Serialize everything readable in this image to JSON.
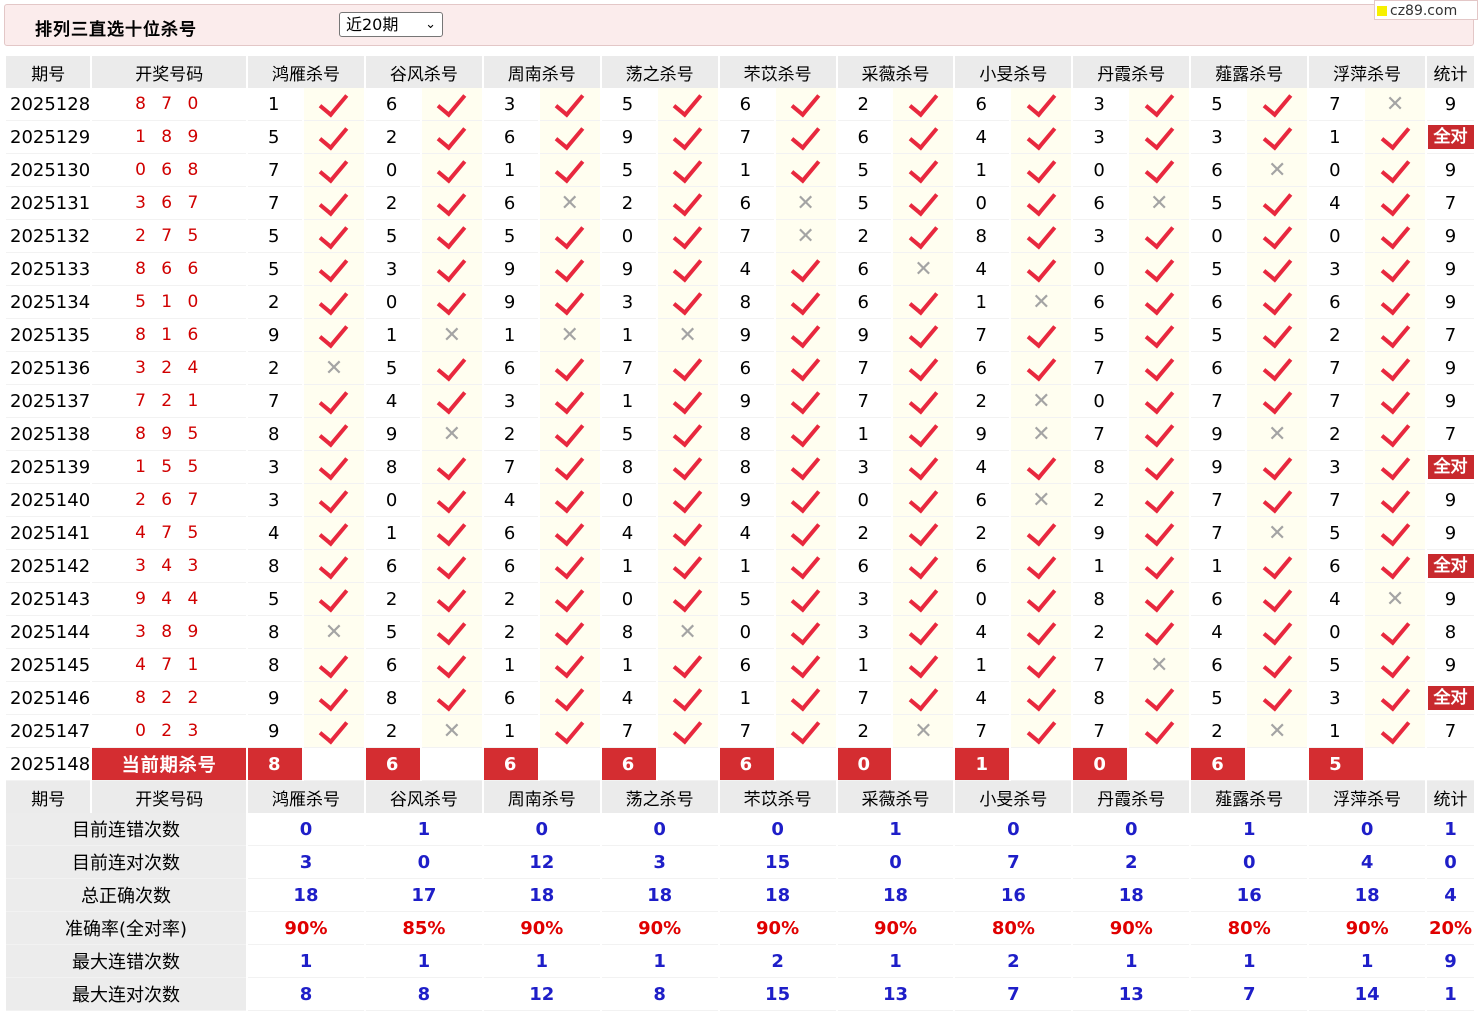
{
  "title": "排列三直选十位杀号",
  "period_select": {
    "value": "近20期",
    "options": [
      "近20期"
    ]
  },
  "watermark": "cz89.com",
  "headers": {
    "period": "期号",
    "draw": "开奖号码",
    "stat": "统计"
  },
  "experts": [
    "鸿雁杀号",
    "谷风杀号",
    "周南杀号",
    "荡之杀号",
    "芣苡杀号",
    "采薇杀号",
    "小旻杀号",
    "丹霞杀号",
    "薤露杀号",
    "浮萍杀号"
  ],
  "rows": [
    {
      "period": "2025128",
      "draw": "8 7 0",
      "kills": [
        "1",
        "6",
        "3",
        "5",
        "6",
        "2",
        "6",
        "3",
        "5",
        "7"
      ],
      "results": [
        "1",
        "1",
        "1",
        "1",
        "1",
        "1",
        "1",
        "1",
        "1",
        "0"
      ],
      "stat": "9"
    },
    {
      "period": "2025129",
      "draw": "1 8 9",
      "kills": [
        "5",
        "2",
        "6",
        "9",
        "7",
        "6",
        "4",
        "3",
        "3",
        "1"
      ],
      "results": [
        "1",
        "1",
        "1",
        "1",
        "1",
        "1",
        "1",
        "1",
        "1",
        "1"
      ],
      "stat": "全对"
    },
    {
      "period": "2025130",
      "draw": "0 6 8",
      "kills": [
        "7",
        "0",
        "1",
        "5",
        "1",
        "5",
        "1",
        "0",
        "6",
        "0"
      ],
      "results": [
        "1",
        "1",
        "1",
        "1",
        "1",
        "1",
        "1",
        "1",
        "0",
        "1"
      ],
      "stat": "9"
    },
    {
      "period": "2025131",
      "draw": "3 6 7",
      "kills": [
        "7",
        "2",
        "6",
        "2",
        "6",
        "5",
        "0",
        "6",
        "5",
        "4"
      ],
      "results": [
        "1",
        "1",
        "0",
        "1",
        "0",
        "1",
        "1",
        "0",
        "1",
        "1"
      ],
      "stat": "7"
    },
    {
      "period": "2025132",
      "draw": "2 7 5",
      "kills": [
        "5",
        "5",
        "5",
        "0",
        "7",
        "2",
        "8",
        "3",
        "0",
        "0"
      ],
      "results": [
        "1",
        "1",
        "1",
        "1",
        "0",
        "1",
        "1",
        "1",
        "1",
        "1"
      ],
      "stat": "9"
    },
    {
      "period": "2025133",
      "draw": "8 6 6",
      "kills": [
        "5",
        "3",
        "9",
        "9",
        "4",
        "6",
        "4",
        "0",
        "5",
        "3"
      ],
      "results": [
        "1",
        "1",
        "1",
        "1",
        "1",
        "0",
        "1",
        "1",
        "1",
        "1"
      ],
      "stat": "9"
    },
    {
      "period": "2025134",
      "draw": "5 1 0",
      "kills": [
        "2",
        "0",
        "9",
        "3",
        "8",
        "6",
        "1",
        "6",
        "6",
        "6"
      ],
      "results": [
        "1",
        "1",
        "1",
        "1",
        "1",
        "1",
        "0",
        "1",
        "1",
        "1"
      ],
      "stat": "9"
    },
    {
      "period": "2025135",
      "draw": "8 1 6",
      "kills": [
        "9",
        "1",
        "1",
        "1",
        "9",
        "9",
        "7",
        "5",
        "5",
        "2"
      ],
      "results": [
        "1",
        "0",
        "0",
        "0",
        "1",
        "1",
        "1",
        "1",
        "1",
        "1"
      ],
      "stat": "7"
    },
    {
      "period": "2025136",
      "draw": "3 2 4",
      "kills": [
        "2",
        "5",
        "6",
        "7",
        "6",
        "7",
        "6",
        "7",
        "6",
        "7"
      ],
      "results": [
        "0",
        "1",
        "1",
        "1",
        "1",
        "1",
        "1",
        "1",
        "1",
        "1"
      ],
      "stat": "9"
    },
    {
      "period": "2025137",
      "draw": "7 2 1",
      "kills": [
        "7",
        "4",
        "3",
        "1",
        "9",
        "7",
        "2",
        "0",
        "7",
        "7"
      ],
      "results": [
        "1",
        "1",
        "1",
        "1",
        "1",
        "1",
        "0",
        "1",
        "1",
        "1"
      ],
      "stat": "9"
    },
    {
      "period": "2025138",
      "draw": "8 9 5",
      "kills": [
        "8",
        "9",
        "2",
        "5",
        "8",
        "1",
        "9",
        "7",
        "9",
        "2"
      ],
      "results": [
        "1",
        "0",
        "1",
        "1",
        "1",
        "1",
        "0",
        "1",
        "0",
        "1"
      ],
      "stat": "7"
    },
    {
      "period": "2025139",
      "draw": "1 5 5",
      "kills": [
        "3",
        "8",
        "7",
        "8",
        "8",
        "3",
        "4",
        "8",
        "9",
        "3"
      ],
      "results": [
        "1",
        "1",
        "1",
        "1",
        "1",
        "1",
        "1",
        "1",
        "1",
        "1"
      ],
      "stat": "全对"
    },
    {
      "period": "2025140",
      "draw": "2 6 7",
      "kills": [
        "3",
        "0",
        "4",
        "0",
        "9",
        "0",
        "6",
        "2",
        "7",
        "7"
      ],
      "results": [
        "1",
        "1",
        "1",
        "1",
        "1",
        "1",
        "0",
        "1",
        "1",
        "1"
      ],
      "stat": "9"
    },
    {
      "period": "2025141",
      "draw": "4 7 5",
      "kills": [
        "4",
        "1",
        "6",
        "4",
        "4",
        "2",
        "2",
        "9",
        "7",
        "5"
      ],
      "results": [
        "1",
        "1",
        "1",
        "1",
        "1",
        "1",
        "1",
        "1",
        "0",
        "1"
      ],
      "stat": "9"
    },
    {
      "period": "2025142",
      "draw": "3 4 3",
      "kills": [
        "8",
        "6",
        "6",
        "1",
        "1",
        "6",
        "6",
        "1",
        "1",
        "6"
      ],
      "results": [
        "1",
        "1",
        "1",
        "1",
        "1",
        "1",
        "1",
        "1",
        "1",
        "1"
      ],
      "stat": "全对"
    },
    {
      "period": "2025143",
      "draw": "9 4 4",
      "kills": [
        "5",
        "2",
        "2",
        "0",
        "5",
        "3",
        "0",
        "8",
        "6",
        "4"
      ],
      "results": [
        "1",
        "1",
        "1",
        "1",
        "1",
        "1",
        "1",
        "1",
        "1",
        "0"
      ],
      "stat": "9"
    },
    {
      "period": "2025144",
      "draw": "3 8 9",
      "kills": [
        "8",
        "5",
        "2",
        "8",
        "0",
        "3",
        "4",
        "2",
        "4",
        "0"
      ],
      "results": [
        "0",
        "1",
        "1",
        "0",
        "1",
        "1",
        "1",
        "1",
        "1",
        "1"
      ],
      "stat": "8"
    },
    {
      "period": "2025145",
      "draw": "4 7 1",
      "kills": [
        "8",
        "6",
        "1",
        "1",
        "6",
        "1",
        "1",
        "7",
        "6",
        "5"
      ],
      "results": [
        "1",
        "1",
        "1",
        "1",
        "1",
        "1",
        "1",
        "0",
        "1",
        "1"
      ],
      "stat": "9"
    },
    {
      "period": "2025146",
      "draw": "8 2 2",
      "kills": [
        "9",
        "8",
        "6",
        "4",
        "1",
        "7",
        "4",
        "8",
        "5",
        "3"
      ],
      "results": [
        "1",
        "1",
        "1",
        "1",
        "1",
        "1",
        "1",
        "1",
        "1",
        "1"
      ],
      "stat": "全对"
    },
    {
      "period": "2025147",
      "draw": "0 2 3",
      "kills": [
        "9",
        "2",
        "1",
        "7",
        "7",
        "2",
        "7",
        "7",
        "2",
        "1"
      ],
      "results": [
        "1",
        "0",
        "1",
        "1",
        "1",
        "0",
        "1",
        "1",
        "0",
        "1"
      ],
      "stat": "7"
    }
  ],
  "current": {
    "period": "2025148",
    "label": "当前期杀号",
    "kills": [
      "8",
      "6",
      "6",
      "6",
      "6",
      "0",
      "1",
      "0",
      "6",
      "5"
    ]
  },
  "stats": [
    {
      "label": "目前连错次数",
      "values": [
        "0",
        "1",
        "0",
        "0",
        "0",
        "1",
        "0",
        "0",
        "1",
        "0",
        "1"
      ]
    },
    {
      "label": "目前连对次数",
      "values": [
        "3",
        "0",
        "12",
        "3",
        "15",
        "0",
        "7",
        "2",
        "0",
        "4",
        "0"
      ]
    },
    {
      "label": "总正确次数",
      "values": [
        "18",
        "17",
        "18",
        "18",
        "18",
        "18",
        "16",
        "18",
        "16",
        "18",
        "4"
      ]
    },
    {
      "label": "准确率(全对率)",
      "values": [
        "90%",
        "85%",
        "90%",
        "90%",
        "90%",
        "90%",
        "80%",
        "90%",
        "80%",
        "90%",
        "20%"
      ]
    },
    {
      "label": "最大连错次数",
      "values": [
        "1",
        "1",
        "1",
        "1",
        "2",
        "1",
        "2",
        "1",
        "1",
        "1",
        "9"
      ]
    },
    {
      "label": "最大连对次数",
      "values": [
        "8",
        "8",
        "12",
        "8",
        "15",
        "13",
        "7",
        "13",
        "7",
        "14",
        "1"
      ]
    }
  ]
}
